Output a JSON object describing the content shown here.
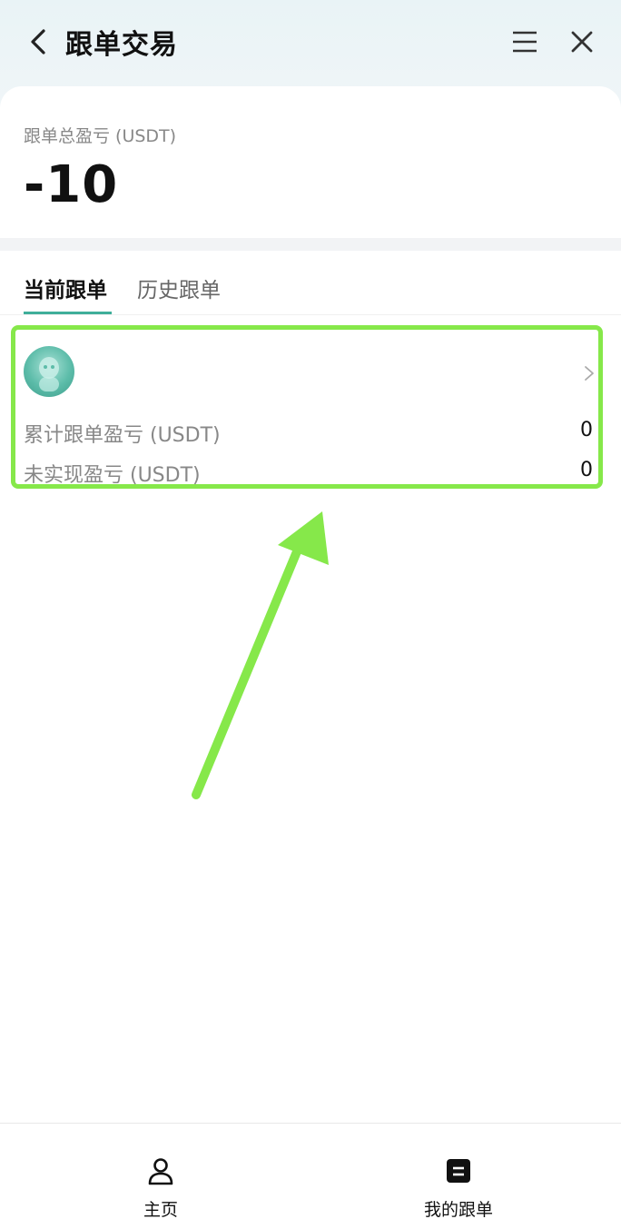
{
  "header": {
    "title": "跟单交易",
    "icons": {
      "back": "chevron-left-icon",
      "menu": "hamburger-menu-icon",
      "close": "close-icon"
    }
  },
  "summary": {
    "label": "跟单总盈亏 (USDT)",
    "value": "-10"
  },
  "tabs": [
    {
      "label": "当前跟单",
      "active": true
    },
    {
      "label": "历史跟单",
      "active": false
    }
  ],
  "follow_card": {
    "avatar": "trader-avatar",
    "rows": [
      {
        "label": "累计跟单盈亏 (USDT)",
        "value": "0"
      },
      {
        "label": "未实现盈亏 (USDT)",
        "value": "0"
      }
    ]
  },
  "bottom_nav": [
    {
      "label": "主页",
      "icon": "user-icon"
    },
    {
      "label": "我的跟单",
      "icon": "document-icon"
    }
  ],
  "colors": {
    "accent": "#3fae9a",
    "highlight": "#86e84a"
  }
}
